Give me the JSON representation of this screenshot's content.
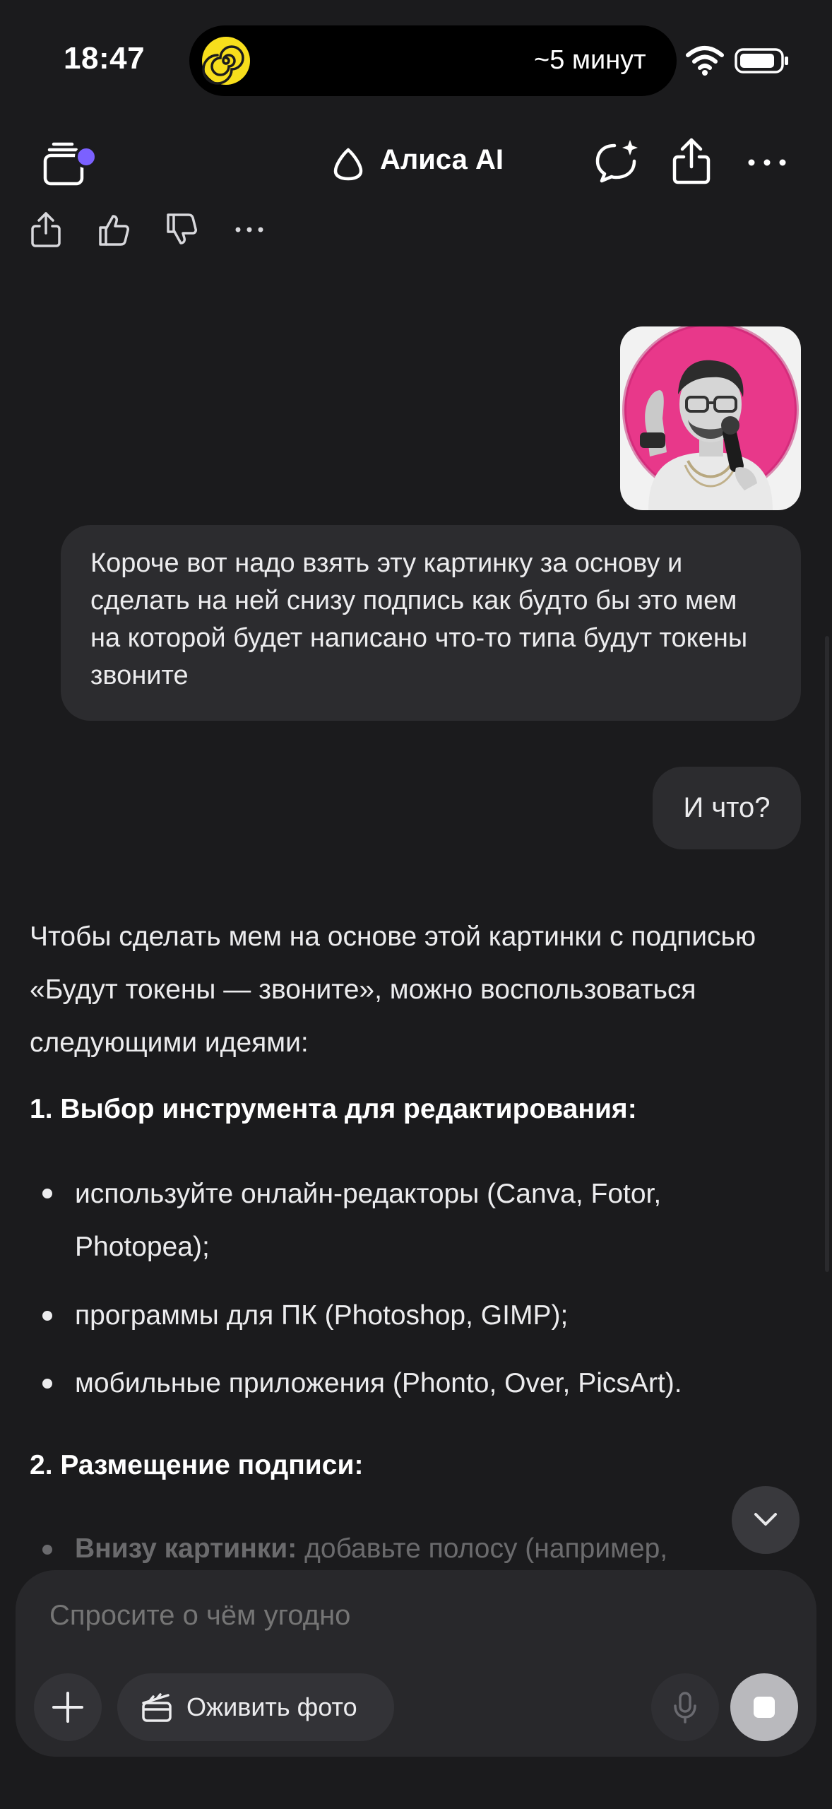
{
  "status_bar": {
    "time": "18:47",
    "activity": "~5 минут"
  },
  "header": {
    "title": "Алиса AI",
    "icons": [
      "chats-icon",
      "alice-logo-icon",
      "new-chat-icon",
      "share-icon",
      "more-icon"
    ]
  },
  "message_actions": {
    "icons": [
      "share-icon",
      "thumbs-up-icon",
      "thumbs-down-icon",
      "more-icon"
    ]
  },
  "messages": {
    "user_text": "Короче вот надо взять эту картинку за основу и сделать на ней снизу подпись как будто бы это мем на которой будет написано что-то типа будут токены звоните",
    "user_short": "И что?"
  },
  "answer": {
    "intro": "Чтобы сделать мем на основе этой картинки с подписью «Будут токены — звоните», можно воспользоваться следующими идеями:",
    "section1_title": "1. Выбор инструмента для редактирования:",
    "section1_items": [
      "используйте онлайн-редакторы (Canva, Fotor, Photopea);",
      "программы для ПК (Photoshop, GIMP);",
      "мобильные приложения (Phonto, Over, PicsArt)."
    ],
    "section2_title": "2. Размещение подписи:",
    "section2_item_bold": "Внизу картинки:",
    "section2_item_rest": " добавьте полосу (например,"
  },
  "composer": {
    "placeholder": "Спросите о чём угодно",
    "animate_label": "Оживить фото"
  },
  "colors": {
    "background": "#1b1b1d",
    "bubble": "#2c2c2f",
    "accent_dot": "#7b61ff",
    "status_icon": "#f7de1c",
    "photo_bg": "#e8388a"
  }
}
